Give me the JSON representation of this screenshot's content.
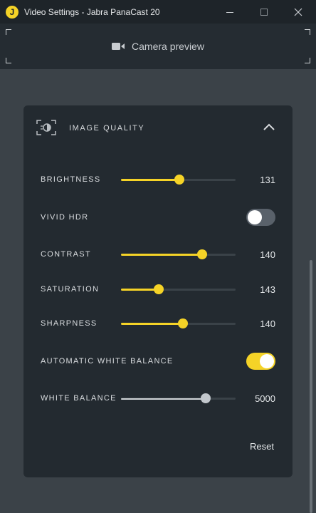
{
  "window": {
    "title": "Video Settings - Jabra PanaCast 20",
    "logo_letter": "J"
  },
  "preview": {
    "label": "Camera preview",
    "icon": "video-camera-icon"
  },
  "image_quality": {
    "title": "IMAGE QUALITY",
    "icon": "image-quality-icon",
    "expanded": true,
    "accent_color": "#f5d327",
    "controls": [
      {
        "label": "BRIGHTNESS",
        "type": "slider",
        "value": "131",
        "fill_fraction": 0.51
      },
      {
        "label": "VIVID HDR",
        "type": "toggle",
        "on": false
      },
      {
        "label": "CONTRAST",
        "type": "slider",
        "value": "140",
        "fill_fraction": 0.71
      },
      {
        "label": "SATURATION",
        "type": "slider",
        "value": "143",
        "fill_fraction": 0.33
      },
      {
        "label": "SHARPNESS",
        "type": "slider",
        "value": "140",
        "fill_fraction": 0.54
      },
      {
        "label": "AUTOMATIC WHITE BALANCE",
        "type": "toggle",
        "on": true
      },
      {
        "label": "WHITE BALANCE",
        "type": "slider",
        "value": "5000",
        "fill_fraction": 0.74,
        "disabled": true
      }
    ],
    "reset_label": "Reset"
  }
}
